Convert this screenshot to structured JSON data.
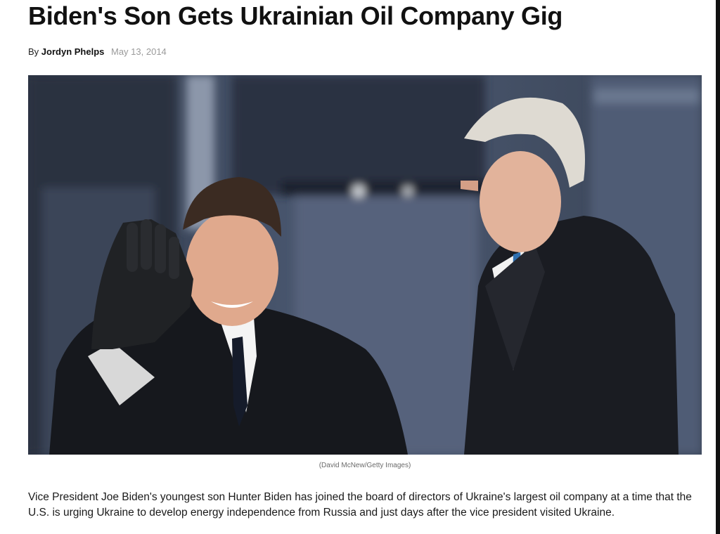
{
  "article": {
    "headline": "Biden's Son Gets Ukrainian Oil Company Gig",
    "byline_prefix": "By",
    "author": "Jordyn Phelps",
    "date": "May 13, 2014",
    "photo_caption": "(David McNew/Getty Images)",
    "body": "Vice President Joe Biden's youngest son Hunter Biden has joined the board of directors of Ukraine's largest oil company at a time that the U.S. is urging Ukraine to develop energy independence from Russia and just days after the vice president visited Ukraine."
  }
}
